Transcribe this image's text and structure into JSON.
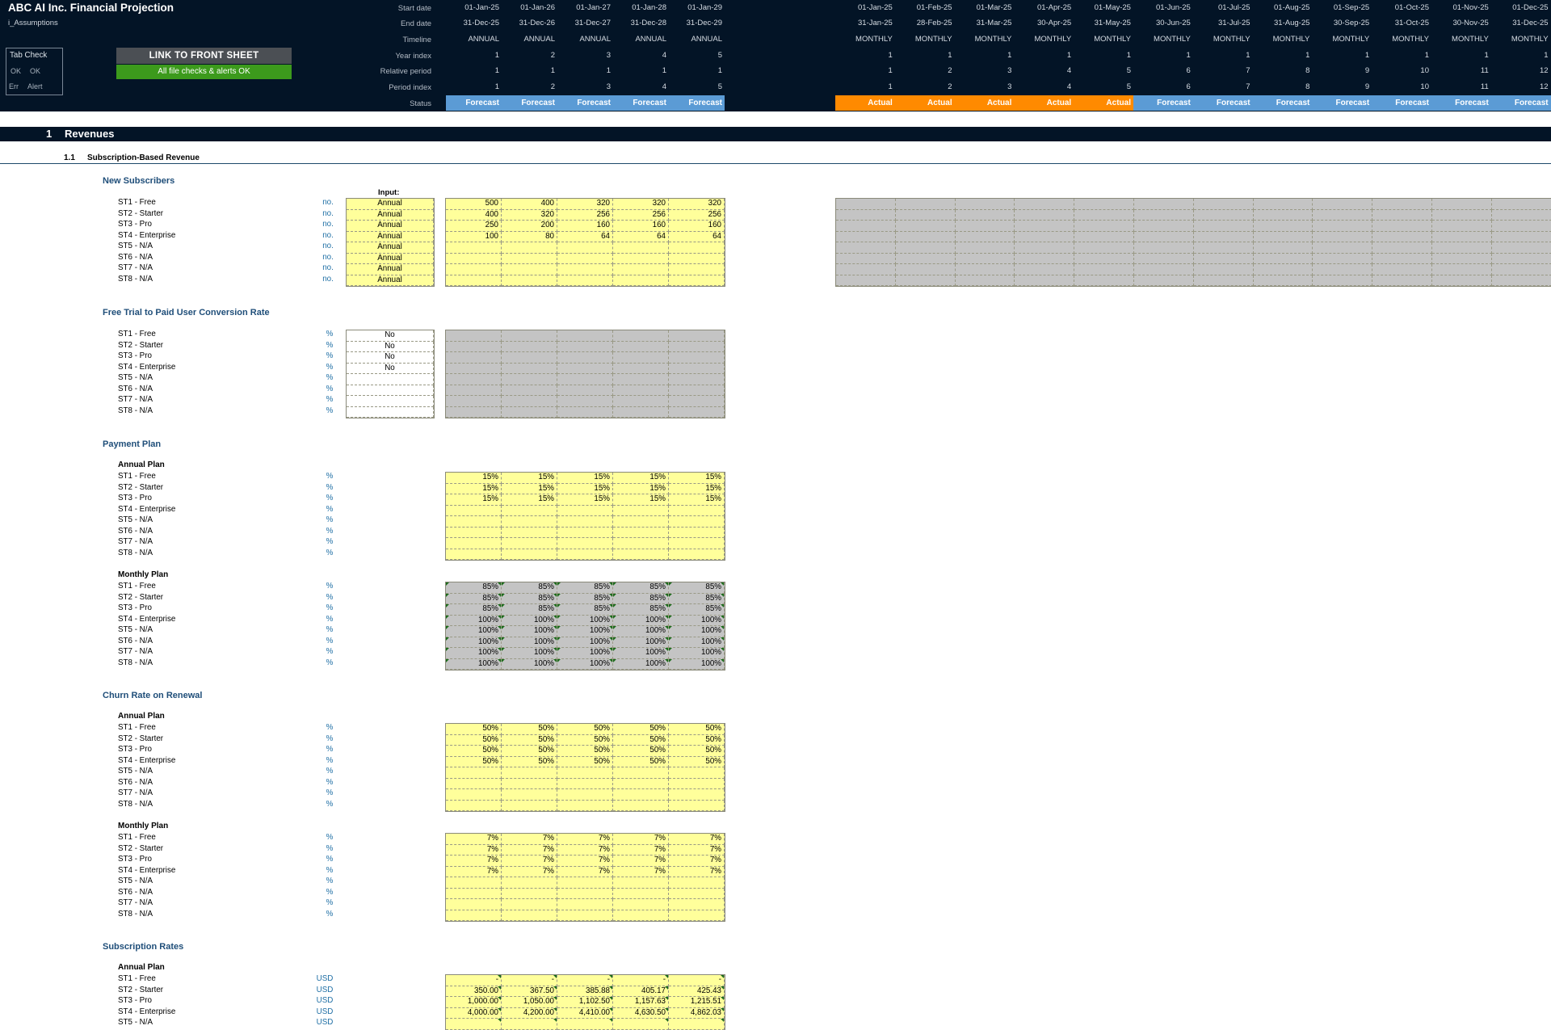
{
  "app": {
    "title": "ABC AI Inc. Financial Projection",
    "sheet": "i_Assumptions"
  },
  "tab_check": {
    "title": "Tab Check",
    "ok1": "OK",
    "ok2": "OK",
    "err": "Err",
    "alert": "Alert"
  },
  "link_button": "LINK TO FRONT SHEET",
  "checks_status": "All file checks & alerts OK",
  "header_labels": [
    "Start date",
    "End date",
    "Timeline",
    "Year index",
    "Relative period",
    "Period index",
    "Status"
  ],
  "annual_cols": [
    {
      "start": "01-Jan-25",
      "end": "31-Dec-25",
      "timeline": "ANNUAL",
      "year": "1",
      "rel": "1",
      "period": "1",
      "status": "Forecast"
    },
    {
      "start": "01-Jan-26",
      "end": "31-Dec-26",
      "timeline": "ANNUAL",
      "year": "2",
      "rel": "1",
      "period": "2",
      "status": "Forecast"
    },
    {
      "start": "01-Jan-27",
      "end": "31-Dec-27",
      "timeline": "ANNUAL",
      "year": "3",
      "rel": "1",
      "period": "3",
      "status": "Forecast"
    },
    {
      "start": "01-Jan-28",
      "end": "31-Dec-28",
      "timeline": "ANNUAL",
      "year": "4",
      "rel": "1",
      "period": "4",
      "status": "Forecast"
    },
    {
      "start": "01-Jan-29",
      "end": "31-Dec-29",
      "timeline": "ANNUAL",
      "year": "5",
      "rel": "1",
      "period": "5",
      "status": "Forecast"
    }
  ],
  "monthly_cols": [
    {
      "start": "01-Jan-25",
      "end": "31-Jan-25",
      "timeline": "MONTHLY",
      "year": "1",
      "rel": "1",
      "period": "1",
      "status": "Actual"
    },
    {
      "start": "01-Feb-25",
      "end": "28-Feb-25",
      "timeline": "MONTHLY",
      "year": "1",
      "rel": "2",
      "period": "2",
      "status": "Actual"
    },
    {
      "start": "01-Mar-25",
      "end": "31-Mar-25",
      "timeline": "MONTHLY",
      "year": "1",
      "rel": "3",
      "period": "3",
      "status": "Actual"
    },
    {
      "start": "01-Apr-25",
      "end": "30-Apr-25",
      "timeline": "MONTHLY",
      "year": "1",
      "rel": "4",
      "period": "4",
      "status": "Actual"
    },
    {
      "start": "01-May-25",
      "end": "31-May-25",
      "timeline": "MONTHLY",
      "year": "1",
      "rel": "5",
      "period": "5",
      "status": "Actual"
    },
    {
      "start": "01-Jun-25",
      "end": "30-Jun-25",
      "timeline": "MONTHLY",
      "year": "1",
      "rel": "6",
      "period": "6",
      "status": "Forecast"
    },
    {
      "start": "01-Jul-25",
      "end": "31-Jul-25",
      "timeline": "MONTHLY",
      "year": "1",
      "rel": "7",
      "period": "7",
      "status": "Forecast"
    },
    {
      "start": "01-Aug-25",
      "end": "31-Aug-25",
      "timeline": "MONTHLY",
      "year": "1",
      "rel": "8",
      "period": "8",
      "status": "Forecast"
    },
    {
      "start": "01-Sep-25",
      "end": "30-Sep-25",
      "timeline": "MONTHLY",
      "year": "1",
      "rel": "9",
      "period": "9",
      "status": "Forecast"
    },
    {
      "start": "01-Oct-25",
      "end": "31-Oct-25",
      "timeline": "MONTHLY",
      "year": "1",
      "rel": "10",
      "period": "10",
      "status": "Forecast"
    },
    {
      "start": "01-Nov-25",
      "end": "30-Nov-25",
      "timeline": "MONTHLY",
      "year": "1",
      "rel": "11",
      "period": "11",
      "status": "Forecast"
    },
    {
      "start": "01-Dec-25",
      "end": "31-Dec-25",
      "timeline": "MONTHLY",
      "year": "1",
      "rel": "12",
      "period": "12",
      "status": "Forecast"
    }
  ],
  "section": {
    "num": "1",
    "title": "Revenues"
  },
  "subsection": {
    "num": "1.1",
    "title": "Subscription-Based Revenue"
  },
  "tiers": [
    "ST1 - Free",
    "ST2 - Starter",
    "ST3 - Pro",
    "ST4 - Enterprise",
    "ST5 - N/A",
    "ST6 - N/A",
    "ST7 - N/A",
    "ST8 - N/A"
  ],
  "new_subscribers": {
    "title": "New Subscribers",
    "input_header": "Input:",
    "unit": "no.",
    "inputs": [
      "Annual",
      "Annual",
      "Annual",
      "Annual",
      "Annual",
      "Annual",
      "Annual",
      "Annual"
    ],
    "rows": [
      [
        "500",
        "400",
        "320",
        "320",
        "320"
      ],
      [
        "400",
        "320",
        "256",
        "256",
        "256"
      ],
      [
        "250",
        "200",
        "160",
        "160",
        "160"
      ],
      [
        "100",
        "80",
        "64",
        "64",
        "64"
      ],
      [
        "",
        "",
        "",
        "",
        ""
      ],
      [
        "",
        "",
        "",
        "",
        ""
      ],
      [
        "",
        "",
        "",
        "",
        ""
      ],
      [
        "",
        "",
        "",
        "",
        ""
      ]
    ]
  },
  "conversion": {
    "title": "Free Trial to Paid User Conversion Rate",
    "unit": "%",
    "inputs": [
      "No",
      "No",
      "No",
      "No",
      "",
      "",
      "",
      ""
    ]
  },
  "payment_plan": {
    "title": "Payment Plan",
    "unit": "%",
    "annual": {
      "title": "Annual Plan",
      "rows": [
        [
          "15%",
          "15%",
          "15%",
          "15%",
          "15%"
        ],
        [
          "15%",
          "15%",
          "15%",
          "15%",
          "15%"
        ],
        [
          "15%",
          "15%",
          "15%",
          "15%",
          "15%"
        ],
        [
          "",
          "",
          "",
          "",
          ""
        ],
        [
          "",
          "",
          "",
          "",
          ""
        ],
        [
          "",
          "",
          "",
          "",
          ""
        ],
        [
          "",
          "",
          "",
          "",
          ""
        ],
        [
          "",
          "",
          "",
          "",
          ""
        ]
      ]
    },
    "monthly": {
      "title": "Monthly Plan",
      "rows": [
        [
          "85%",
          "85%",
          "85%",
          "85%",
          "85%"
        ],
        [
          "85%",
          "85%",
          "85%",
          "85%",
          "85%"
        ],
        [
          "85%",
          "85%",
          "85%",
          "85%",
          "85%"
        ],
        [
          "100%",
          "100%",
          "100%",
          "100%",
          "100%"
        ],
        [
          "100%",
          "100%",
          "100%",
          "100%",
          "100%"
        ],
        [
          "100%",
          "100%",
          "100%",
          "100%",
          "100%"
        ],
        [
          "100%",
          "100%",
          "100%",
          "100%",
          "100%"
        ],
        [
          "100%",
          "100%",
          "100%",
          "100%",
          "100%"
        ]
      ]
    }
  },
  "churn": {
    "title": "Churn Rate on Renewal",
    "unit": "%",
    "annual": {
      "title": "Annual Plan",
      "rows": [
        [
          "50%",
          "50%",
          "50%",
          "50%",
          "50%"
        ],
        [
          "50%",
          "50%",
          "50%",
          "50%",
          "50%"
        ],
        [
          "50%",
          "50%",
          "50%",
          "50%",
          "50%"
        ],
        [
          "50%",
          "50%",
          "50%",
          "50%",
          "50%"
        ],
        [
          "",
          "",
          "",
          "",
          ""
        ],
        [
          "",
          "",
          "",
          "",
          ""
        ],
        [
          "",
          "",
          "",
          "",
          ""
        ],
        [
          "",
          "",
          "",
          "",
          ""
        ]
      ]
    },
    "monthly": {
      "title": "Monthly Plan",
      "rows": [
        [
          "7%",
          "7%",
          "7%",
          "7%",
          "7%"
        ],
        [
          "7%",
          "7%",
          "7%",
          "7%",
          "7%"
        ],
        [
          "7%",
          "7%",
          "7%",
          "7%",
          "7%"
        ],
        [
          "7%",
          "7%",
          "7%",
          "7%",
          "7%"
        ],
        [
          "",
          "",
          "",
          "",
          ""
        ],
        [
          "",
          "",
          "",
          "",
          ""
        ],
        [
          "",
          "",
          "",
          "",
          ""
        ],
        [
          "",
          "",
          "",
          "",
          ""
        ]
      ]
    }
  },
  "rates": {
    "title": "Subscription Rates",
    "unit": "USD",
    "annual": {
      "title": "Annual Plan",
      "tiers": [
        "ST1 - Free",
        "ST2 - Starter",
        "ST3 - Pro",
        "ST4 - Enterprise",
        "ST5 - N/A"
      ],
      "rows": [
        [
          "-",
          "-",
          "-",
          "-",
          "-"
        ],
        [
          "350.00",
          "367.50",
          "385.88",
          "405.17",
          "425.43"
        ],
        [
          "1,000.00",
          "1,050.00",
          "1,102.50",
          "1,157.63",
          "1,215.51"
        ],
        [
          "4,000.00",
          "4,200.00",
          "4,410.00",
          "4,630.50",
          "4,862.03"
        ],
        [
          "",
          "",
          "",
          "",
          ""
        ]
      ]
    }
  },
  "colors": {
    "header_bg": "#031426",
    "input_yellow": "#ffff9b",
    "calc_grey": "#c4c4c4",
    "forecast": "#5b9bd5",
    "actual": "#ff8a00",
    "ok_green": "#3c9a1c",
    "section_blue": "#1f4e79"
  }
}
